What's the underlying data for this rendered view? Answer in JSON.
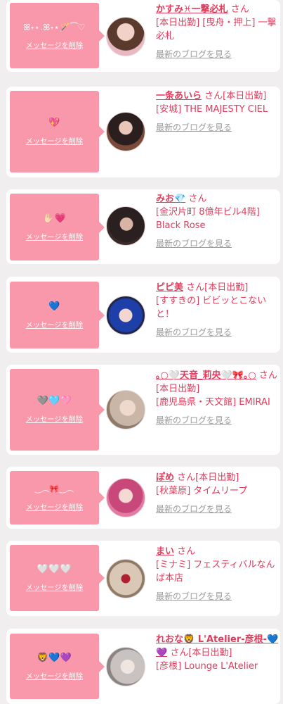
{
  "delete_label": "メッセージを削除",
  "blog_label": "最新のブログを見る",
  "cards": [
    {
      "message": "ꕤ˖⋆.ꕤ˖⋆🪄⁀♡",
      "name": "かすみ♓一撃必札",
      "suffix": "さん",
      "shop": "[本日出勤] [曳舟・押上] 一撃必札"
    },
    {
      "message": "💖",
      "name": "一条あいら",
      "suffix": "さん[本日出勤]",
      "shop": "[安城] THE MAJESTY CIEL"
    },
    {
      "message": "✋🏻💗",
      "name": "みお💎",
      "suffix": "さん",
      "shop": "[金沢片町 8億年ビル4階] Black Rose"
    },
    {
      "message": "💙",
      "name": "ピピ美",
      "suffix": "さん[本日出勤]",
      "shop": "[すすきの] ビビッとこないと！"
    },
    {
      "message": "🩶🩵🩷",
      "name": "｡○🤍天音_莉央🤍🎀｡○",
      "suffix": "さん[本日出勤]",
      "shop": "[鹿児島県・天文館] EMIRAI"
    },
    {
      "message": "‿︵🎀‿︵",
      "name": "ぽめ",
      "suffix": "さん[本日出勤]",
      "shop": "[秋葉原] タイムリープ"
    },
    {
      "message": "🤍🤍🤍",
      "name": "まい",
      "suffix": "さん",
      "shop": "[ミナミ] フェスティバルなんば本店"
    },
    {
      "message": "🦁💙💜",
      "name": "れおな🦁 L'Atelier-彦根-💙💜",
      "suffix": "さん[本日出勤]",
      "shop": "[彦根] Lounge L'Atelier"
    }
  ]
}
